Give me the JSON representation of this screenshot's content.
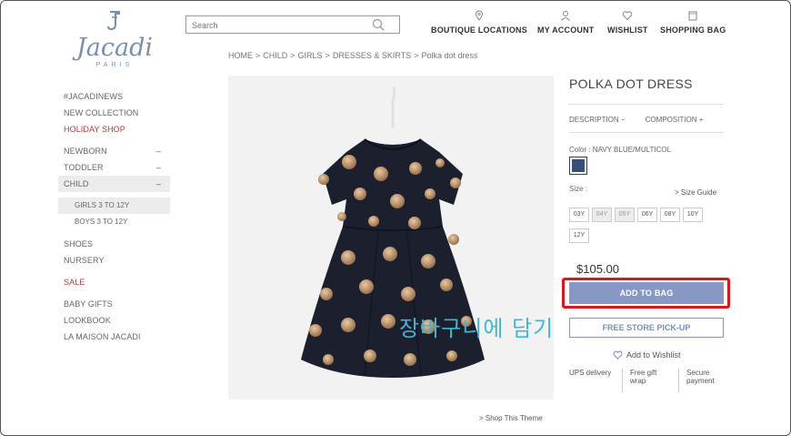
{
  "brand": {
    "name": "Jacadi",
    "sub": "PARIS"
  },
  "search": {
    "placeholder": "Search"
  },
  "header_nav": [
    {
      "label": "BOUTIQUE LOCATIONS",
      "icon": "location-pin-icon"
    },
    {
      "label": "MY ACCOUNT",
      "icon": "user-icon"
    },
    {
      "label": "WISHLIST",
      "icon": "heart-icon"
    },
    {
      "label": "SHOPPING BAG",
      "icon": "bag-icon"
    }
  ],
  "breadcrumb": [
    "HOME",
    "CHILD",
    "GIRLS",
    "DRESSES & SKIRTS",
    "Polka dot dress"
  ],
  "breadcrumb_sep": ">",
  "sidebar": {
    "items": [
      {
        "label": "#JACADINEWS"
      },
      {
        "label": "NEW COLLECTION"
      },
      {
        "label": "HOLIDAY SHOP"
      },
      {
        "label": "NEWBORN",
        "toggle": "–"
      },
      {
        "label": "TODDLER",
        "toggle": "–"
      },
      {
        "label": "CHILD",
        "toggle": "–"
      },
      {
        "label": "GIRLS 3 TO 12Y"
      },
      {
        "label": "BOYS 3 TO 12Y"
      },
      {
        "label": "SHOES"
      },
      {
        "label": "NURSERY"
      },
      {
        "label": "SALE"
      },
      {
        "label": "BABY GIFTS"
      },
      {
        "label": "LOOKBOOK"
      },
      {
        "label": "LA MAISON JACADI"
      }
    ]
  },
  "product": {
    "title": "POLKA DOT DRESS",
    "tab_description": "DESCRIPTION",
    "tab_description_icon": "−",
    "tab_composition": "COMPOSITION",
    "tab_composition_icon": "+",
    "color_label": "Color : NAVY BLUE/MULTICOL",
    "swatch_color": "#3a4f77",
    "size_label": "Size :",
    "size_guide": "> Size Guide",
    "sizes": [
      {
        "label": "03Y",
        "available": true
      },
      {
        "label": "04Y",
        "available": false
      },
      {
        "label": "05Y",
        "available": false
      },
      {
        "label": "06Y",
        "available": true
      },
      {
        "label": "08Y",
        "available": true
      },
      {
        "label": "10Y",
        "available": true
      },
      {
        "label": "12Y",
        "available": true
      }
    ],
    "price": "$105.00",
    "add_to_bag": "ADD TO BAG",
    "pickup": "FREE STORE PICK-UP",
    "wishlist": "Add to Wishlist",
    "services": [
      "UPS delivery",
      "Free gift wrap",
      "Secure payment"
    ],
    "shop_theme": "> Shop This Theme"
  },
  "caption": "장바구니에 담기",
  "colors": {
    "accent": "#8798c4",
    "highlight": "#e0141c",
    "sale_red": "#b53a3a",
    "caption": "#3fb7d4"
  }
}
